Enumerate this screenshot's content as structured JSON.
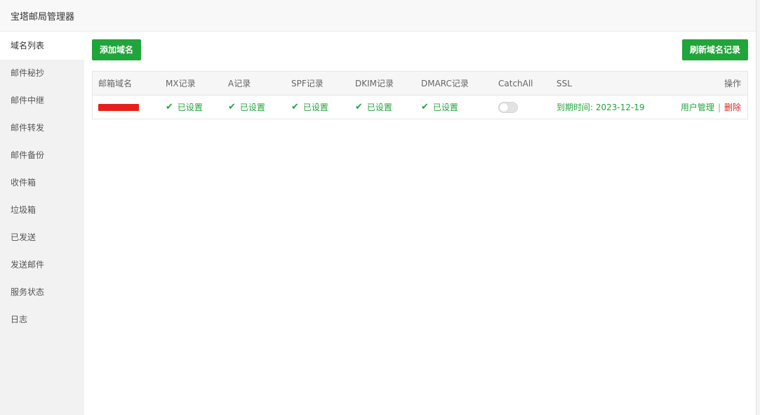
{
  "app": {
    "title": "宝塔邮局管理器"
  },
  "sidebar": {
    "items": [
      {
        "label": "域名列表",
        "active": true
      },
      {
        "label": "邮件秘抄"
      },
      {
        "label": "邮件中继"
      },
      {
        "label": "邮件转发"
      },
      {
        "label": "邮件备份"
      },
      {
        "label": "收件箱"
      },
      {
        "label": "垃圾箱"
      },
      {
        "label": "已发送"
      },
      {
        "label": "发送邮件"
      },
      {
        "label": "服务状态"
      },
      {
        "label": "日志"
      }
    ]
  },
  "toolbar": {
    "add_label": "添加域名",
    "refresh_label": "刷新域名记录"
  },
  "table": {
    "headers": {
      "domain": "邮箱域名",
      "mx": "MX记录",
      "a": "A记录",
      "spf": "SPF记录",
      "dkim": "DKIM记录",
      "dmarc": "DMARC记录",
      "catchall": "CatchAll",
      "ssl": "SSL",
      "actions": "操作"
    },
    "rows": [
      {
        "domain_redacted": true,
        "mx": "已设置",
        "a": "已设置",
        "spf": "已设置",
        "dkim": "已设置",
        "dmarc": "已设置",
        "catchall_enabled": false,
        "ssl": "到期时间: 2023-12-19",
        "action_users": "用户管理",
        "separator": "|",
        "action_delete": "删除"
      }
    ]
  },
  "colors": {
    "accent": "#20a53a",
    "danger": "#e7201a"
  },
  "icons": {
    "status_ok": "check-icon"
  }
}
